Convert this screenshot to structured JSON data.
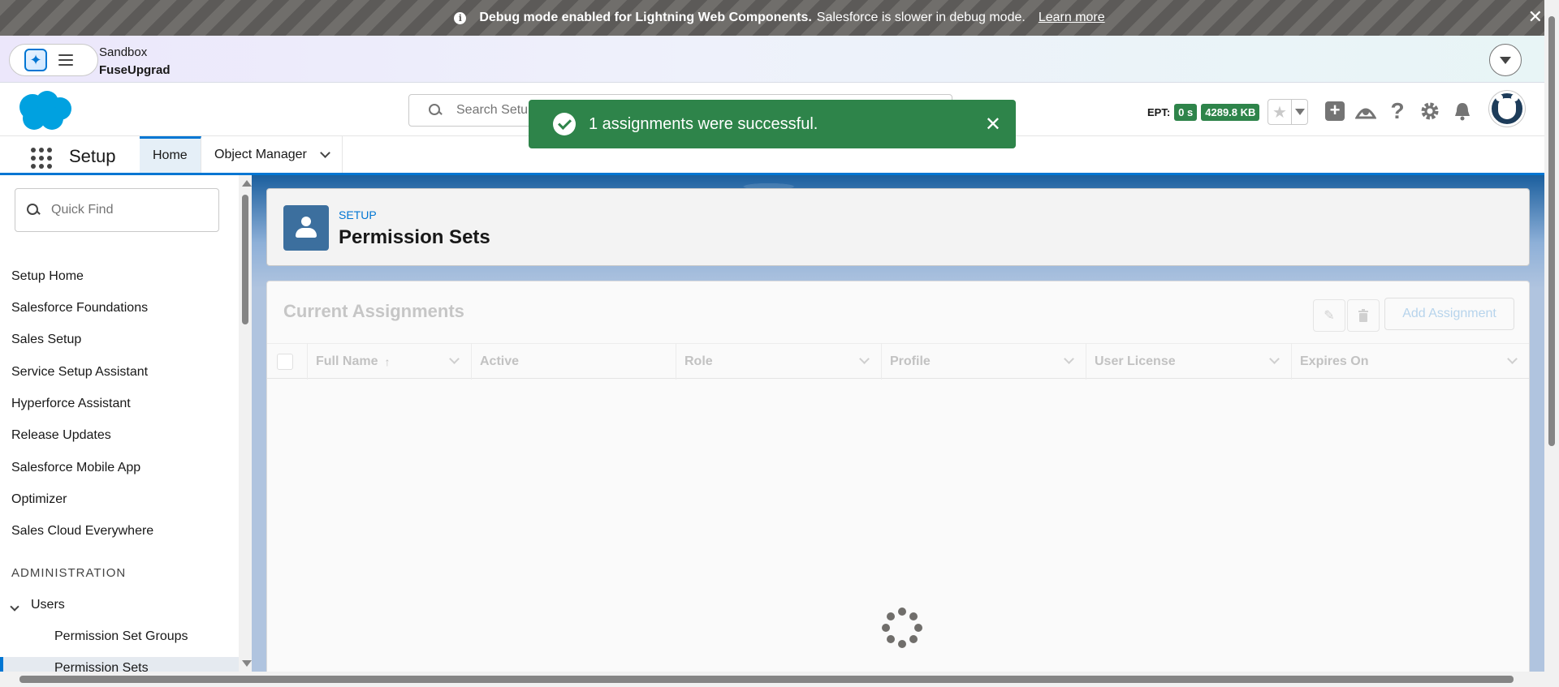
{
  "debug_banner": {
    "bold_text": "Debug mode enabled for Lightning Web Components.",
    "text": "Salesforce is slower in debug mode.",
    "link": "Learn more",
    "close": "✕"
  },
  "sandbox": {
    "label": "Sandbox",
    "org": "FuseUpgrad"
  },
  "header": {
    "search_placeholder": "Search Setup",
    "ept_label": "EPT:",
    "ept_value": "0 s",
    "ept_size": "4289.8 KB",
    "help": "?"
  },
  "nav": {
    "app_name": "Setup",
    "tabs": [
      {
        "label": "Home"
      },
      {
        "label": "Object Manager"
      }
    ]
  },
  "toast": {
    "message": "1 assignments were successful.",
    "close": "✕"
  },
  "sidebar": {
    "quick_find_placeholder": "Quick Find",
    "items": [
      {
        "label": "Setup Home"
      },
      {
        "label": "Salesforce Foundations"
      },
      {
        "label": "Sales Setup"
      },
      {
        "label": "Service Setup Assistant"
      },
      {
        "label": "Hyperforce Assistant"
      },
      {
        "label": "Release Updates"
      },
      {
        "label": "Salesforce Mobile App"
      },
      {
        "label": "Optimizer"
      },
      {
        "label": "Sales Cloud Everywhere"
      }
    ],
    "section_heading": "ADMINISTRATION",
    "users_label": "Users",
    "sub_items": [
      {
        "label": "Permission Set Groups"
      },
      {
        "label": "Permission Sets"
      }
    ]
  },
  "page_header": {
    "eyebrow": "SETUP",
    "title": "Permission Sets"
  },
  "card": {
    "title": "Current Assignments",
    "add_button": "Add Assignment",
    "columns": [
      {
        "label": "Full Name"
      },
      {
        "label": "Active"
      },
      {
        "label": "Role"
      },
      {
        "label": "Profile"
      },
      {
        "label": "User License"
      },
      {
        "label": "Expires On"
      }
    ]
  },
  "colors": {
    "brand": "#0176d3",
    "success": "#2e844a",
    "banner_gray": "#706e6b"
  }
}
